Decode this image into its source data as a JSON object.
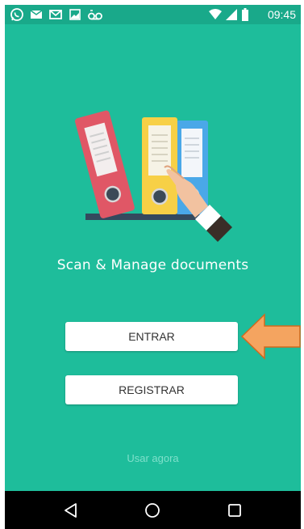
{
  "status_bar": {
    "time": "09:45",
    "left_icons": [
      "whatsapp-icon",
      "message-icon",
      "gmail-icon",
      "image-icon",
      "voicemail-icon"
    ],
    "right_icons": [
      "wifi-icon",
      "signal-icon",
      "battery-icon"
    ]
  },
  "main": {
    "tagline": "Scan & Manage documents",
    "enter_label": "ENTRAR",
    "register_label": "REGISTRAR",
    "use_now_label": "Usar agora"
  },
  "nav_bar": {
    "buttons": [
      "back-icon",
      "home-icon",
      "recents-icon"
    ]
  },
  "colors": {
    "background": "#1ebd9b",
    "status_bar": "#19a98a",
    "annotation_arrow": "#f4a460"
  }
}
